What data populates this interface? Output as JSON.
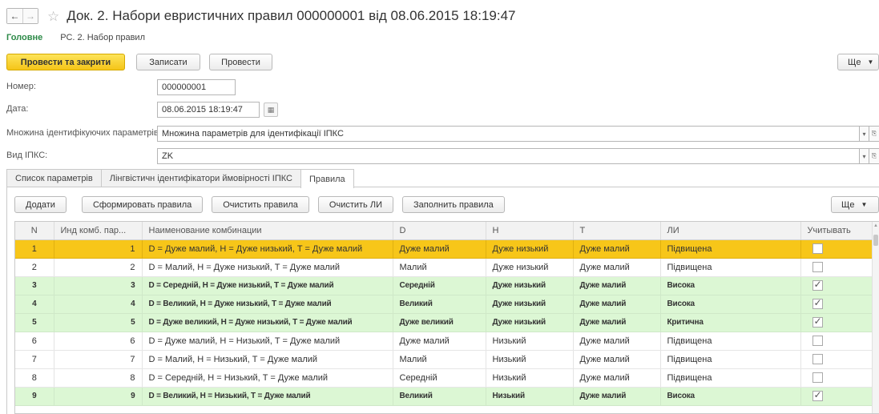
{
  "window": {
    "title": "Док. 2. Набори евристичних правил 000000001 від 08.06.2015 18:19:47",
    "back_glyph": "←",
    "forward_glyph": "→",
    "star_glyph": "☆"
  },
  "subnav": {
    "main": "Головне",
    "register": "РС. 2. Набор правил"
  },
  "toolbar": {
    "post_close": "Провести та закрити",
    "save": "Записати",
    "post": "Провести",
    "more": "Ще",
    "more_arrow": "▼"
  },
  "form": {
    "number_label": "Номер:",
    "number_value": "000000001",
    "date_label": "Дата:",
    "date_value": "08.06.2015 18:19:47",
    "calendar_glyph": "▦",
    "param_set_label": "Множина ідентифікуючих параметрів:",
    "param_set_value": "Множина параметрів для ідентифікації ІПКС",
    "type_label": "Вид ІПКС:",
    "type_value": "ZK",
    "dropdown_glyph": "▾",
    "open_glyph": "⎘"
  },
  "tabs": {
    "params": "Список параметрів",
    "linguistic": "Лінгвістичн ідентифікатори ймовірності ІПКС",
    "rules": "Правила"
  },
  "grid_toolbar": {
    "add": "Додати",
    "generate": "Сформировать правила",
    "clear_rules": "Очистить правила",
    "clear_li": "Очистить ЛИ",
    "fill_rules": "Заполнить правила",
    "more": "Ще",
    "more_arrow": "▼"
  },
  "table": {
    "columns": {
      "n": "N",
      "combo_index": "Инд комб. пар...",
      "combo_name": "Наименование комбинации",
      "d": "D",
      "h": "H",
      "t": "T",
      "li": "ЛИ",
      "consider": "Учитывать"
    },
    "rows": [
      {
        "n": "1",
        "idx": "1",
        "name": "D = Дуже малий, H = Дуже низький, T = Дуже малий",
        "d": "Дуже малий",
        "h": "Дуже низький",
        "t": "Дуже малий",
        "li": "Підвищена",
        "checked": false,
        "selected": true
      },
      {
        "n": "2",
        "idx": "2",
        "name": "D = Малий, H = Дуже низький, T = Дуже малий",
        "d": "Малий",
        "h": "Дуже низький",
        "t": "Дуже малий",
        "li": "Підвищена",
        "checked": false,
        "selected": false
      },
      {
        "n": "3",
        "idx": "3",
        "name": "D = Середній, H = Дуже низький, T = Дуже малий",
        "d": "Середній",
        "h": "Дуже низький",
        "t": "Дуже малий",
        "li": "Висока",
        "checked": true,
        "selected": false
      },
      {
        "n": "4",
        "idx": "4",
        "name": "D = Великий, H = Дуже низький, T = Дуже малий",
        "d": "Великий",
        "h": "Дуже низький",
        "t": "Дуже малий",
        "li": "Висока",
        "checked": true,
        "selected": false
      },
      {
        "n": "5",
        "idx": "5",
        "name": "D = Дуже великий, H = Дуже низький, T = Дуже малий",
        "d": "Дуже великий",
        "h": "Дуже низький",
        "t": "Дуже малий",
        "li": "Критична",
        "checked": true,
        "selected": false
      },
      {
        "n": "6",
        "idx": "6",
        "name": "D = Дуже малий, H = Низький, T = Дуже малий",
        "d": "Дуже малий",
        "h": "Низький",
        "t": "Дуже малий",
        "li": "Підвищена",
        "checked": false,
        "selected": false
      },
      {
        "n": "7",
        "idx": "7",
        "name": "D = Малий, H = Низький, T = Дуже малий",
        "d": "Малий",
        "h": "Низький",
        "t": "Дуже малий",
        "li": "Підвищена",
        "checked": false,
        "selected": false
      },
      {
        "n": "8",
        "idx": "8",
        "name": "D = Середній, H = Низький, T = Дуже малий",
        "d": "Середній",
        "h": "Низький",
        "t": "Дуже малий",
        "li": "Підвищена",
        "checked": false,
        "selected": false
      },
      {
        "n": "9",
        "idx": "9",
        "name": "D = Великий, H = Низький, T = Дуже малий",
        "d": "Великий",
        "h": "Низький",
        "t": "Дуже малий",
        "li": "Висока",
        "checked": true,
        "selected": false
      }
    ]
  },
  "colors": {
    "selected_row": "#f7c619",
    "checked_row": "#dcf7d4",
    "primary_button": "#f5c518",
    "active_nav": "#2d8a48"
  }
}
